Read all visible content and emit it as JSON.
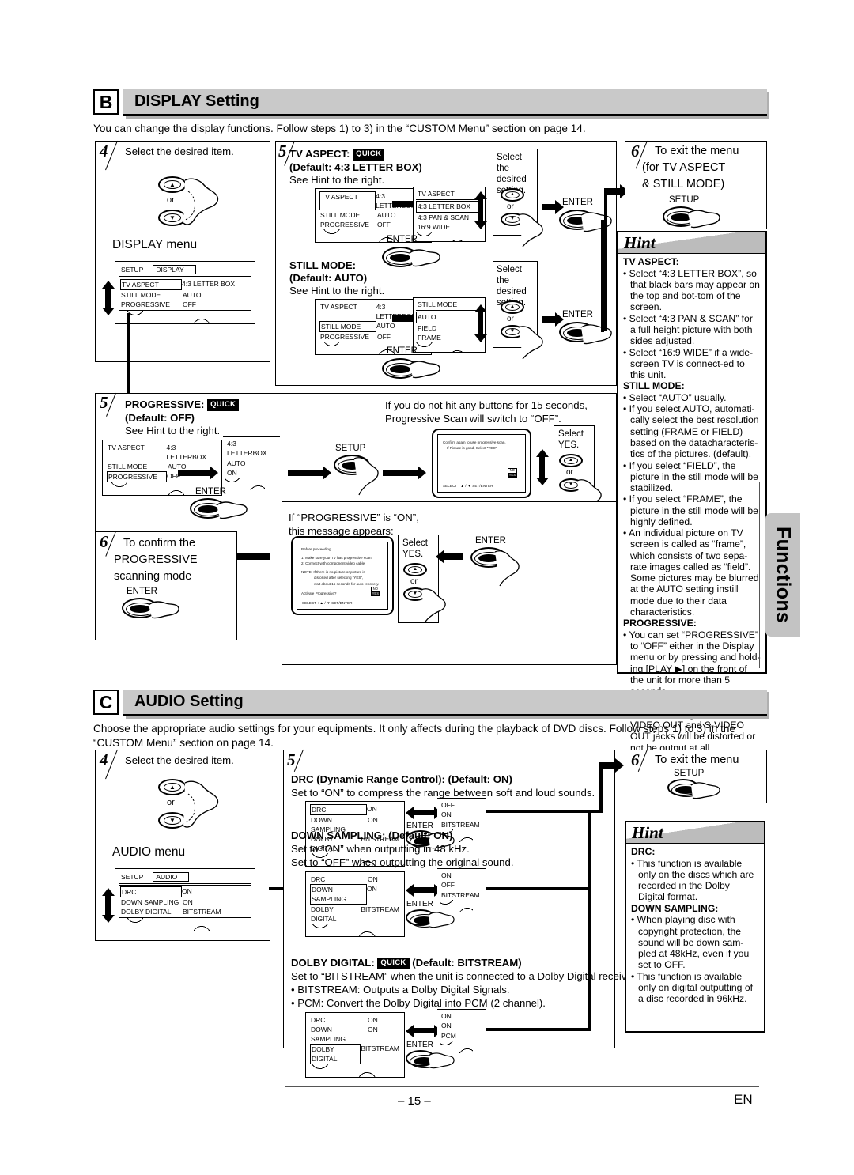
{
  "page": {
    "number": "– 15 –",
    "lang": "EN",
    "side_tab": "Functions"
  },
  "sections": [
    {
      "letter": "B",
      "title": "DISPLAY Setting",
      "description": "You can change the display functions. Follow steps 1) to 3) in the “CUSTOM Menu” section on page 14."
    },
    {
      "letter": "C",
      "title": "AUDIO Setting",
      "description": "Choose the appropriate audio settings for your equipments. It only affects during the playback of DVD discs. Follow steps 1) to 3) in the “CUSTOM Menu” section on page 14."
    }
  ],
  "display": {
    "step4": {
      "num": "4",
      "text": "Select the desired item.",
      "or": "or",
      "menu_label": "DISPLAY menu",
      "osd": {
        "setup": "SETUP",
        "tab": "DISPLAY",
        "rows": [
          {
            "label": "TV ASPECT",
            "value": "4:3 LETTER BOX",
            "selected": true
          },
          {
            "label": "STILL MODE",
            "value": "AUTO",
            "selected": false
          },
          {
            "label": "PROGRESSIVE",
            "value": "OFF",
            "selected": false
          }
        ]
      }
    },
    "step5_tv": {
      "num": "5",
      "heading": "TV ASPECT:",
      "quick": "QUICK",
      "default": "(Default: 4:3 LETTER BOX)",
      "hintnote": "See Hint to the right.",
      "menu": {
        "rows": [
          {
            "label": "TV ASPECT",
            "value": "4:3 LETTERBOX",
            "selected": true
          },
          {
            "label": "STILL MODE",
            "value": "AUTO",
            "selected": false
          },
          {
            "label": "PROGRESSIVE",
            "value": "OFF",
            "selected": false
          }
        ]
      },
      "options": {
        "title": "TV ASPECT",
        "items": [
          "4:3 LETTER BOX",
          "4:3 PAN & SCAN",
          "16:9 WIDE"
        ],
        "selected": "4:3 LETTER BOX"
      },
      "enter": "ENTER",
      "select_text": "Select the desired setting.",
      "or": "or",
      "enter2": "ENTER"
    },
    "step5_still": {
      "heading": "STILL MODE:",
      "default": "(Default: AUTO)",
      "hintnote": "See Hint to the right.",
      "menu": {
        "rows": [
          {
            "label": "TV ASPECT",
            "value": "4:3 LETTERBOX",
            "selected": false
          },
          {
            "label": "STILL MODE",
            "value": "AUTO",
            "selected": true
          },
          {
            "label": "PROGRESSIVE",
            "value": "OFF",
            "selected": false
          }
        ]
      },
      "options": {
        "title": "STILL MODE",
        "items": [
          "AUTO",
          "FIELD",
          "FRAME"
        ],
        "selected": "AUTO"
      },
      "enter": "ENTER",
      "select_text": "Select the desired setting.",
      "or": "or",
      "enter2": "ENTER"
    },
    "step6": {
      "num": "6",
      "line1": "To exit the menu",
      "line2": "(for TV ASPECT",
      "line3": "& STILL MODE)",
      "setup": "SETUP"
    },
    "step5_prog": {
      "num": "5",
      "heading": "PROGRESSIVE:",
      "quick": "QUICK",
      "default": "(Default: OFF)",
      "hintnote": "See Hint to the right.",
      "note_top_l1": "If you do not hit any buttons for 15 seconds,",
      "note_top_l2": "Progressive Scan will switch to “OFF”.",
      "menu": {
        "rows": [
          {
            "label": "TV ASPECT",
            "value": "4:3 LETTERBOX",
            "selected": false
          },
          {
            "label": "STILL MODE",
            "value": "AUTO",
            "selected": false
          },
          {
            "label": "PROGRESSIVE",
            "value": "OFF",
            "selected": true
          }
        ]
      },
      "menu_after": {
        "rows": [
          "4:3 LETTERBOX",
          "AUTO",
          "ON"
        ]
      },
      "enter": "ENTER",
      "setup": "SETUP",
      "tv1": {
        "line1": "Confirm again to use progressive scan.",
        "line2": "If Picture is good, Select “YES”.",
        "btn_no": "NO",
        "btn_yes": "YES",
        "foot": "SELECT : ▲ / ▼        SET/ENTER"
      },
      "select_yes": "Select YES.",
      "or": "or",
      "msg_l1": "If “PROGRESSIVE” is “ON”,",
      "msg_l2": "this message appears:",
      "tv2": {
        "title": "Before proceeding...",
        "l1": "1. Make sure your TV has progressive scan.",
        "l2": "2. Connect with component video cable",
        "note1": "NOTE:  If there is no picture or picture is",
        "note2": "distorted after selecting “YES”,",
        "note3": "wait about 15 seconds for auto recovery.",
        "activate": "Activate Progressive?",
        "btn_no": "NO",
        "btn_yes": "YES",
        "foot": "SELECT : ▲ / ▼        SET/ENTER"
      },
      "select_yes2": "Select YES.",
      "or2": "or",
      "enter2": "ENTER"
    },
    "step6_confirm": {
      "num": "6",
      "line1": "To confirm the",
      "line2": "PROGRESSIVE",
      "line3": "scanning mode",
      "enter": "ENTER"
    },
    "hint": {
      "title": "Hint",
      "blocks": [
        {
          "head": "TV ASPECT:",
          "items": [
            "Select “4:3 LETTER BOX”, so that black bars may appear on the top and bot-tom of the screen.",
            "Select “4:3 PAN & SCAN” for a full height picture with both sides adjusted.",
            "Select “16:9 WIDE” if a wide-screen TV is connect-ed to this unit."
          ]
        },
        {
          "head": "STILL MODE:",
          "items": [
            "Select “AUTO” usually.",
            "If you select AUTO, automati-cally select the best resolution setting (FRAME or FIELD) based on the datacharacteris-tics of the pictures. (default).",
            "If you select “FIELD”, the picture in the still mode will be stabilized.",
            "If you select “FRAME”, the picture in the still mode will be highly defined.",
            "An individual picture on TV screen is called as “frame”, which consists of two sepa-rate images called as “field”. Some pictures may be blurred at the AUTO setting instill mode due to their data characteristics."
          ]
        },
        {
          "head": "PROGRESSIVE:",
          "items": [
            "You can set “PROGRESSIVE” to “OFF” either in the Display menu or by pressing and hold-ing [PLAY ▶] on the front of the unit for more than 5 seconds.",
            "When “PROGRESSIVE” is “ON”, video signals from VIDEO OUT and S-VIDEO OUT jacks will be distorted or not be output at all."
          ]
        }
      ]
    }
  },
  "audio": {
    "step4": {
      "num": "4",
      "text": "Select the desired item.",
      "or": "or",
      "menu_label": "AUDIO menu",
      "osd": {
        "setup": "SETUP",
        "tab": "AUDIO",
        "rows": [
          {
            "label": "DRC",
            "value": "ON",
            "selected": true
          },
          {
            "label": "DOWN SAMPLING",
            "value": "ON",
            "selected": false
          },
          {
            "label": "DOLBY DIGITAL",
            "value": "BITSTREAM",
            "selected": false
          }
        ]
      }
    },
    "step5": {
      "num": "5"
    },
    "drc": {
      "heading": "DRC (Dynamic Range Control): (Default: ON)",
      "desc": "Set to “ON” to compress the range between soft and loud sounds.",
      "menu_rows": [
        {
          "label": "DRC",
          "value": "ON",
          "selected": true
        },
        {
          "label": "DOWN SAMPLING",
          "value": "ON",
          "selected": false
        },
        {
          "label": "DOLBY DIGITAL",
          "value": "BITSTREAM",
          "selected": false
        }
      ],
      "after_rows": [
        "OFF",
        "ON",
        "BITSTREAM"
      ],
      "enter": "ENTER"
    },
    "down_sampling": {
      "heading": "DOWN SAMPLING: (Default: ON)",
      "desc1": "Set to “ON” when outputting in 48 kHz.",
      "desc2": "Set to “OFF” when outputting the original sound.",
      "menu_rows": [
        {
          "label": "DRC",
          "value": "ON",
          "selected": false
        },
        {
          "label": "DOWN SAMPLING",
          "value": "ON",
          "selected": true
        },
        {
          "label": "DOLBY DIGITAL",
          "value": "BITSTREAM",
          "selected": false
        }
      ],
      "after_rows": [
        "ON",
        "OFF",
        "BITSTREAM"
      ],
      "enter": "ENTER"
    },
    "dolby_digital": {
      "heading": "DOLBY DIGITAL:",
      "quick": "QUICK",
      "default": "(Default: BITSTREAM)",
      "desc": "Set to “BITSTREAM” when the unit is connected to a Dolby Digital receiver.",
      "bullet1": "BITSTREAM: Outputs a Dolby Digital Signals.",
      "bullet2": "PCM: Convert the Dolby Digital into PCM (2 channel).",
      "menu_rows": [
        {
          "label": "DRC",
          "value": "ON",
          "selected": false
        },
        {
          "label": "DOWN SAMPLING",
          "value": "ON",
          "selected": false
        },
        {
          "label": "DOLBY DIGITAL",
          "value": "BITSTREAM",
          "selected": true
        }
      ],
      "after_rows": [
        "ON",
        "ON",
        "PCM"
      ],
      "enter": "ENTER"
    },
    "step6": {
      "num": "6",
      "line1": "To exit the menu",
      "setup": "SETUP"
    },
    "hint": {
      "title": "Hint",
      "blocks": [
        {
          "head": "DRC:",
          "items": [
            "This function is available only on the discs which are recorded in the Dolby Digital format."
          ]
        },
        {
          "head": "DOWN SAMPLING:",
          "items": [
            "When playing disc with copyright protection, the sound will be down sam-pled at 48kHz, even if you set to OFF.",
            "This function is available only on digital outputting of a disc recorded in 96kHz."
          ]
        }
      ]
    }
  }
}
